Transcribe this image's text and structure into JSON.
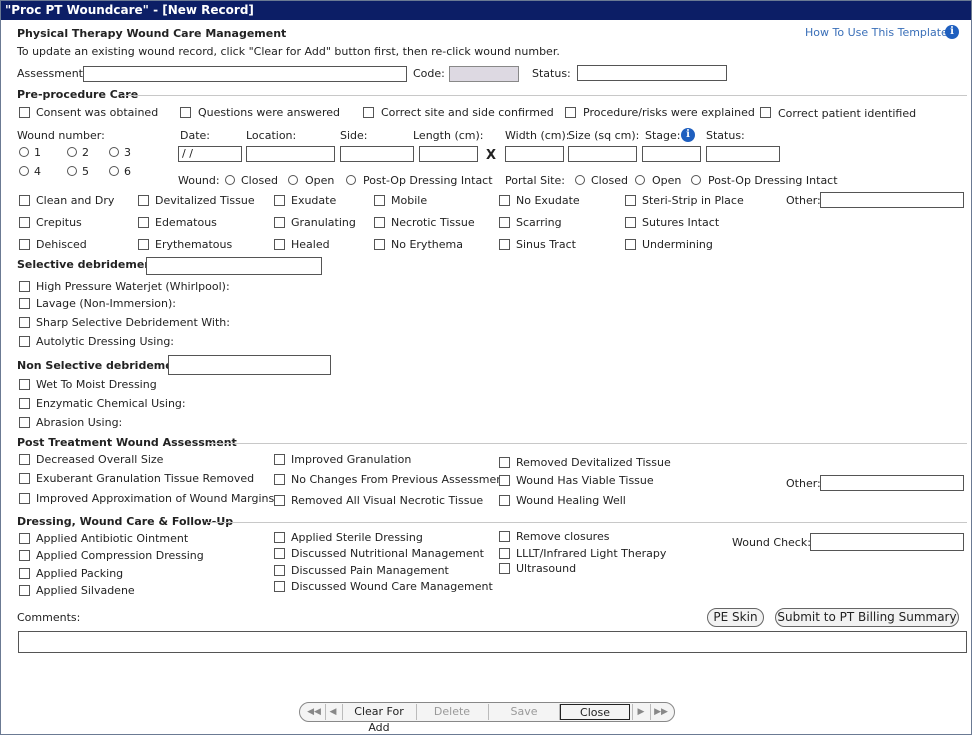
{
  "window": {
    "title": "\"Proc PT Woundcare\" - [New Record]"
  },
  "header": {
    "heading": "Physical Therapy Wound Care Management",
    "instructions": "To update an existing wound record, click \"Clear for Add\" button first, then re-click wound number.",
    "help_link": "How To Use This Template",
    "assessment_label": "Assessment:",
    "code_label": "Code:",
    "status_label": "Status:"
  },
  "preprocedure": {
    "title": "Pre-procedure Care",
    "items": [
      "Consent was obtained",
      "Questions were answered",
      "Correct site and side confirmed",
      "Procedure/risks were explained",
      "Correct patient identified"
    ]
  },
  "wound": {
    "number_label": "Wound number:",
    "numbers": [
      "1",
      "2",
      "3",
      "4",
      "5",
      "6"
    ],
    "date_label": "Date:",
    "date_value": " / /",
    "location_label": "Location:",
    "side_label": "Side:",
    "length_label": "Length (cm):",
    "x_label": "X",
    "width_label": "Width (cm):",
    "size_label": "Size (sq cm):",
    "stage_label": "Stage:",
    "status_label": "Status:",
    "wound_label": "Wound:",
    "wound_options": [
      "Closed",
      "Open",
      "Post-Op Dressing Intact"
    ],
    "portal_label": "Portal Site:",
    "portal_options": [
      "Closed",
      "Open",
      "Post-Op Dressing Intact"
    ],
    "other_label": "Other:",
    "conditions": [
      [
        "Clean and Dry",
        "Devitalized Tissue",
        "Exudate",
        "Mobile",
        "No Exudate",
        "Steri-Strip in Place"
      ],
      [
        "Crepitus",
        "Edematous",
        "Granulating",
        "Necrotic Tissue",
        "Scarring",
        "Sutures Intact"
      ],
      [
        "Dehisced",
        "Erythematous",
        "Healed",
        "No Erythema",
        "Sinus Tract",
        "Undermining"
      ]
    ]
  },
  "selective": {
    "title": "Selective debridement:",
    "items": [
      "High Pressure Waterjet (Whirlpool):",
      "Lavage (Non-Immersion):",
      "Sharp Selective Debridement With:",
      "Autolytic Dressing Using:"
    ]
  },
  "nonselective": {
    "title": "Non Selective debridement:",
    "items": [
      "Wet To Moist Dressing",
      "Enzymatic Chemical Using:",
      "Abrasion Using:"
    ]
  },
  "posttreatment": {
    "title": "Post Treatment Wound Assessment",
    "col1": [
      "Decreased Overall Size",
      "Exuberant Granulation Tissue Removed",
      "Improved Approximation of Wound Margins"
    ],
    "col2": [
      "Improved Granulation",
      "No Changes From Previous Assessment",
      "Removed All Visual Necrotic Tissue"
    ],
    "col3": [
      "Removed Devitalized Tissue",
      "Wound Has Viable Tissue",
      "Wound Healing Well"
    ],
    "other_label": "Other:"
  },
  "dressing": {
    "title": "Dressing, Wound Care & Follow-Up",
    "col1": [
      "Applied Antibiotic Ointment",
      "Applied Compression Dressing",
      "Applied Packing",
      "Applied Silvadene"
    ],
    "col2": [
      "Applied Sterile Dressing",
      "Discussed Nutritional Management",
      "Discussed Pain Management",
      "Discussed Wound Care Management"
    ],
    "col3": [
      "Remove closures",
      "LLLT/Infrared Light Therapy",
      "Ultrasound"
    ],
    "wound_check_label": "Wound Check:"
  },
  "comments": {
    "label": "Comments:",
    "pe_skin": "PE Skin",
    "submit": "Submit to PT Billing Summary"
  },
  "nav": {
    "first": "◀◀",
    "prev": "◀",
    "clear": "Clear For Add",
    "delete": "Delete",
    "save": "Save",
    "close": "Close",
    "next": "▶",
    "last": "▶▶"
  }
}
